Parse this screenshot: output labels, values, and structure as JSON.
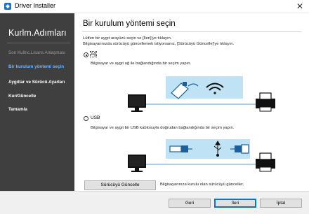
{
  "window": {
    "title": "Driver Installer",
    "close_glyph": "✕"
  },
  "sidebar": {
    "title": "Kurlm.Adımları",
    "steps": [
      {
        "label": "Son Kullnc.Lisans Anlaşması",
        "state": "done"
      },
      {
        "label": "Bir kurulum yöntemi seçin",
        "state": "active"
      },
      {
        "label": "Aygıtlar ve Sürücü.Ayarları",
        "state": "pending"
      },
      {
        "label": "Kur/Güncelle",
        "state": "pending"
      },
      {
        "label": "Tamamla",
        "state": "pending"
      }
    ]
  },
  "main": {
    "heading": "Bir kurulum yöntemi seçin",
    "instructions": [
      "Lütfen bir aygıt arayüzü seçin ve [İleri]'ye tıklayın.",
      "Bilgisayarınızda sürücüyü güncellemek istiyorsanız, [Sürücüyü Güncelle]'ye tıklayın."
    ],
    "options": [
      {
        "label": "Ağ",
        "description": "Bilgisayar ve aygıt ağ ile bağlandığında bir seçim yapın.",
        "selected": true
      },
      {
        "label": "USB",
        "description": "Bilgisayar ve aygıt bir USB kablosuyla doğrudan bağlandığında bir seçim yapın.",
        "selected": false
      }
    ],
    "update_button": "Sürücüyü Güncelle",
    "update_hint": "Bilgisayarınıza kurulu olan sürücüyü günceller."
  },
  "footer": {
    "back": "Geri",
    "next": "İleri",
    "cancel": "İptal"
  },
  "colors": {
    "sidebar_bg": "#3f3f3f",
    "active_step": "#6fb4ff",
    "illustration_bg": "#bfe3f4",
    "cable": "#5aa0d8"
  },
  "icons": [
    "app-icon",
    "close-icon",
    "monitor-icon",
    "printer-icon",
    "ethernet-plug-icon",
    "wifi-icon",
    "usb-a-plug-icon",
    "usb-b-plug-icon",
    "usb-symbol-icon"
  ]
}
